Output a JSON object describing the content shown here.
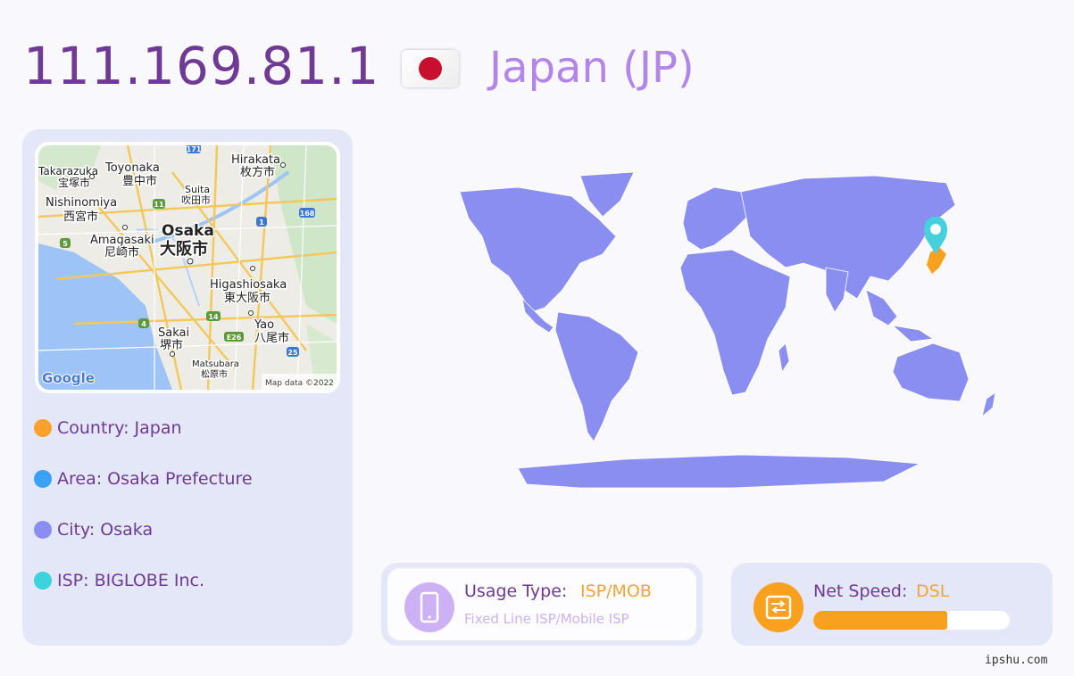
{
  "header": {
    "ip": "111.169.81.1",
    "country_title": "Japan (JP)",
    "flag_icon": "japan-flag-icon"
  },
  "map": {
    "labels": {
      "takarazuka_en": "Takarazuka",
      "takarazuka_jp": "宝塚市",
      "toyonaka_en": "Toyonaka",
      "toyonaka_jp": "豊中市",
      "hirakata_en": "Hirakata",
      "hirakata_jp": "枚方市",
      "suita_en": "Suita",
      "suita_jp": "吹田市",
      "nishinomiya_en": "Nishinomiya",
      "nishinomiya_jp": "西宮市",
      "amagasaki_en": "Amagasaki",
      "amagasaki_jp": "尼崎市",
      "osaka_en": "Osaka",
      "osaka_jp": "大阪市",
      "higashiosaka_en": "Higashiosaka",
      "higashiosaka_jp": "東大阪市",
      "yao_en": "Yao",
      "yao_jp": "八尾市",
      "sakai_en": "Sakai",
      "sakai_jp": "堺市",
      "matsubara_en": "Matsubara",
      "matsubara_jp": "松原市"
    },
    "route_badges": {
      "r171": "171",
      "r11": "11",
      "r1": "1",
      "r168": "168",
      "r5": "5",
      "r4": "4",
      "r14": "14",
      "re26": "E26",
      "r25": "25"
    },
    "google_logo": "Google",
    "attribution": "Map data ©2022"
  },
  "info": [
    {
      "label": "Country: Japan",
      "color": "#f9a12c"
    },
    {
      "label": "Area: Osaka Prefecture",
      "color": "#3ba1f4"
    },
    {
      "label": "City: Osaka",
      "color": "#8a8ef0"
    },
    {
      "label": "ISP: BIGLOBE Inc.",
      "color": "#3ad3de"
    }
  ],
  "world_map": {
    "land_color": "#8a8ef0",
    "highlight_color": "#f9a11e",
    "marker_color": "#46d0dd",
    "marker_icon": "map-pin-icon"
  },
  "usage": {
    "label": "Usage Type:",
    "value": "ISP/MOB",
    "sub": "Fixed Line ISP/Mobile ISP",
    "icon": "mobile-phone-icon"
  },
  "speed": {
    "label": "Net Speed:",
    "value": "DSL",
    "icon": "hard-drive-icon",
    "level": 0.68
  },
  "footer": {
    "site": "ipshu.com"
  }
}
